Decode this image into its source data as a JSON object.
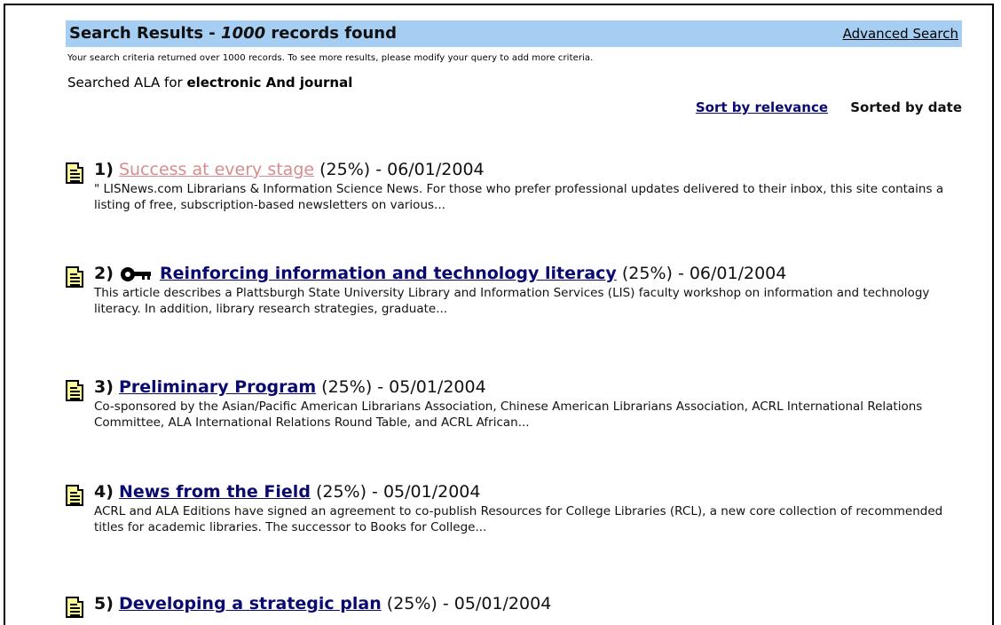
{
  "header": {
    "title_prefix": "Search Results - ",
    "count": "1000",
    "title_suffix": " records found",
    "advanced_search": "Advanced Search"
  },
  "notice": "Your search criteria returned over 1000 records. To see more results, please modify your query to add more criteria.",
  "searched": {
    "prefix": "Searched ALA for ",
    "query": "electronic And journal"
  },
  "sort": {
    "relevance": "Sort by relevance",
    "date": "Sorted by date"
  },
  "results": [
    {
      "num": "1)",
      "title": "Success at every stage",
      "meta": " (25%) - 06/01/2004",
      "visited": true,
      "locked": false,
      "desc": "\" LISNews.com Librarians & Information Science News. For those who prefer professional updates delivered to their inbox, this site contains a listing of free, subscription-based newsletters on various..."
    },
    {
      "num": "2)",
      "title": "Reinforcing information and technology literacy",
      "meta": " (25%) - 06/01/2004",
      "visited": false,
      "locked": true,
      "desc": "This article describes a Plattsburgh State University Library and Information Services (LIS) faculty workshop on information and technology literacy. In addition, library research strategies, graduate..."
    },
    {
      "num": "3)",
      "title": "Preliminary Program",
      "meta": " (25%) - 05/01/2004",
      "visited": false,
      "locked": false,
      "desc": "Co-sponsored by the Asian/Pacific American Librarians Association, Chinese American Librarians Association, ACRL International Relations Committee, ALA International Relations Round Table, and ACRL African..."
    },
    {
      "num": "4)",
      "title": "News from the Field",
      "meta": " (25%) - 05/01/2004",
      "visited": false,
      "locked": false,
      "desc": "ACRL and ALA Editions have signed an agreement to co-publish Resources for College Libraries (RCL), a new core collection of recommended titles for academic libraries. The successor to Books for College..."
    },
    {
      "num": "5)",
      "title": "Developing a strategic plan",
      "meta": " (25%) - 05/01/2004",
      "visited": false,
      "locked": false,
      "desc": ""
    }
  ],
  "colors": {
    "header_bg": "#a6cdf2",
    "link": "#0a0a6e",
    "visited_link": "#d88c90",
    "doc_icon_fill": "#ffff99"
  }
}
